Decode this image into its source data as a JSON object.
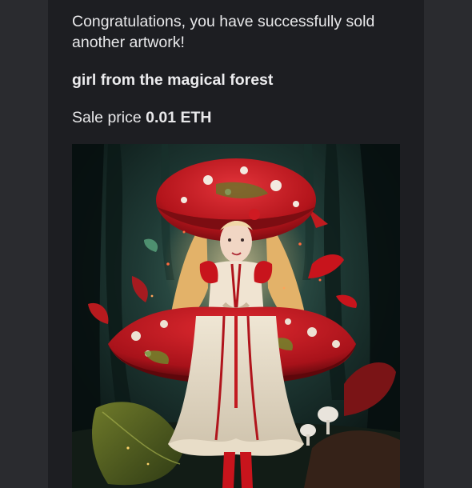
{
  "email": {
    "message": "Congratulations, you have successfully sold another artwork!",
    "artwork_title": "girl from the magical forest",
    "sale_label": "Sale price",
    "sale_amount": "0.01",
    "sale_currency": "ETH"
  },
  "artwork_image": {
    "icon": "nft-artwork-image"
  },
  "colors": {
    "page_background": "#26272b",
    "card_background": "#1d1e22",
    "text": "#e8e8ea",
    "mushroom_red": "#c8141c"
  }
}
